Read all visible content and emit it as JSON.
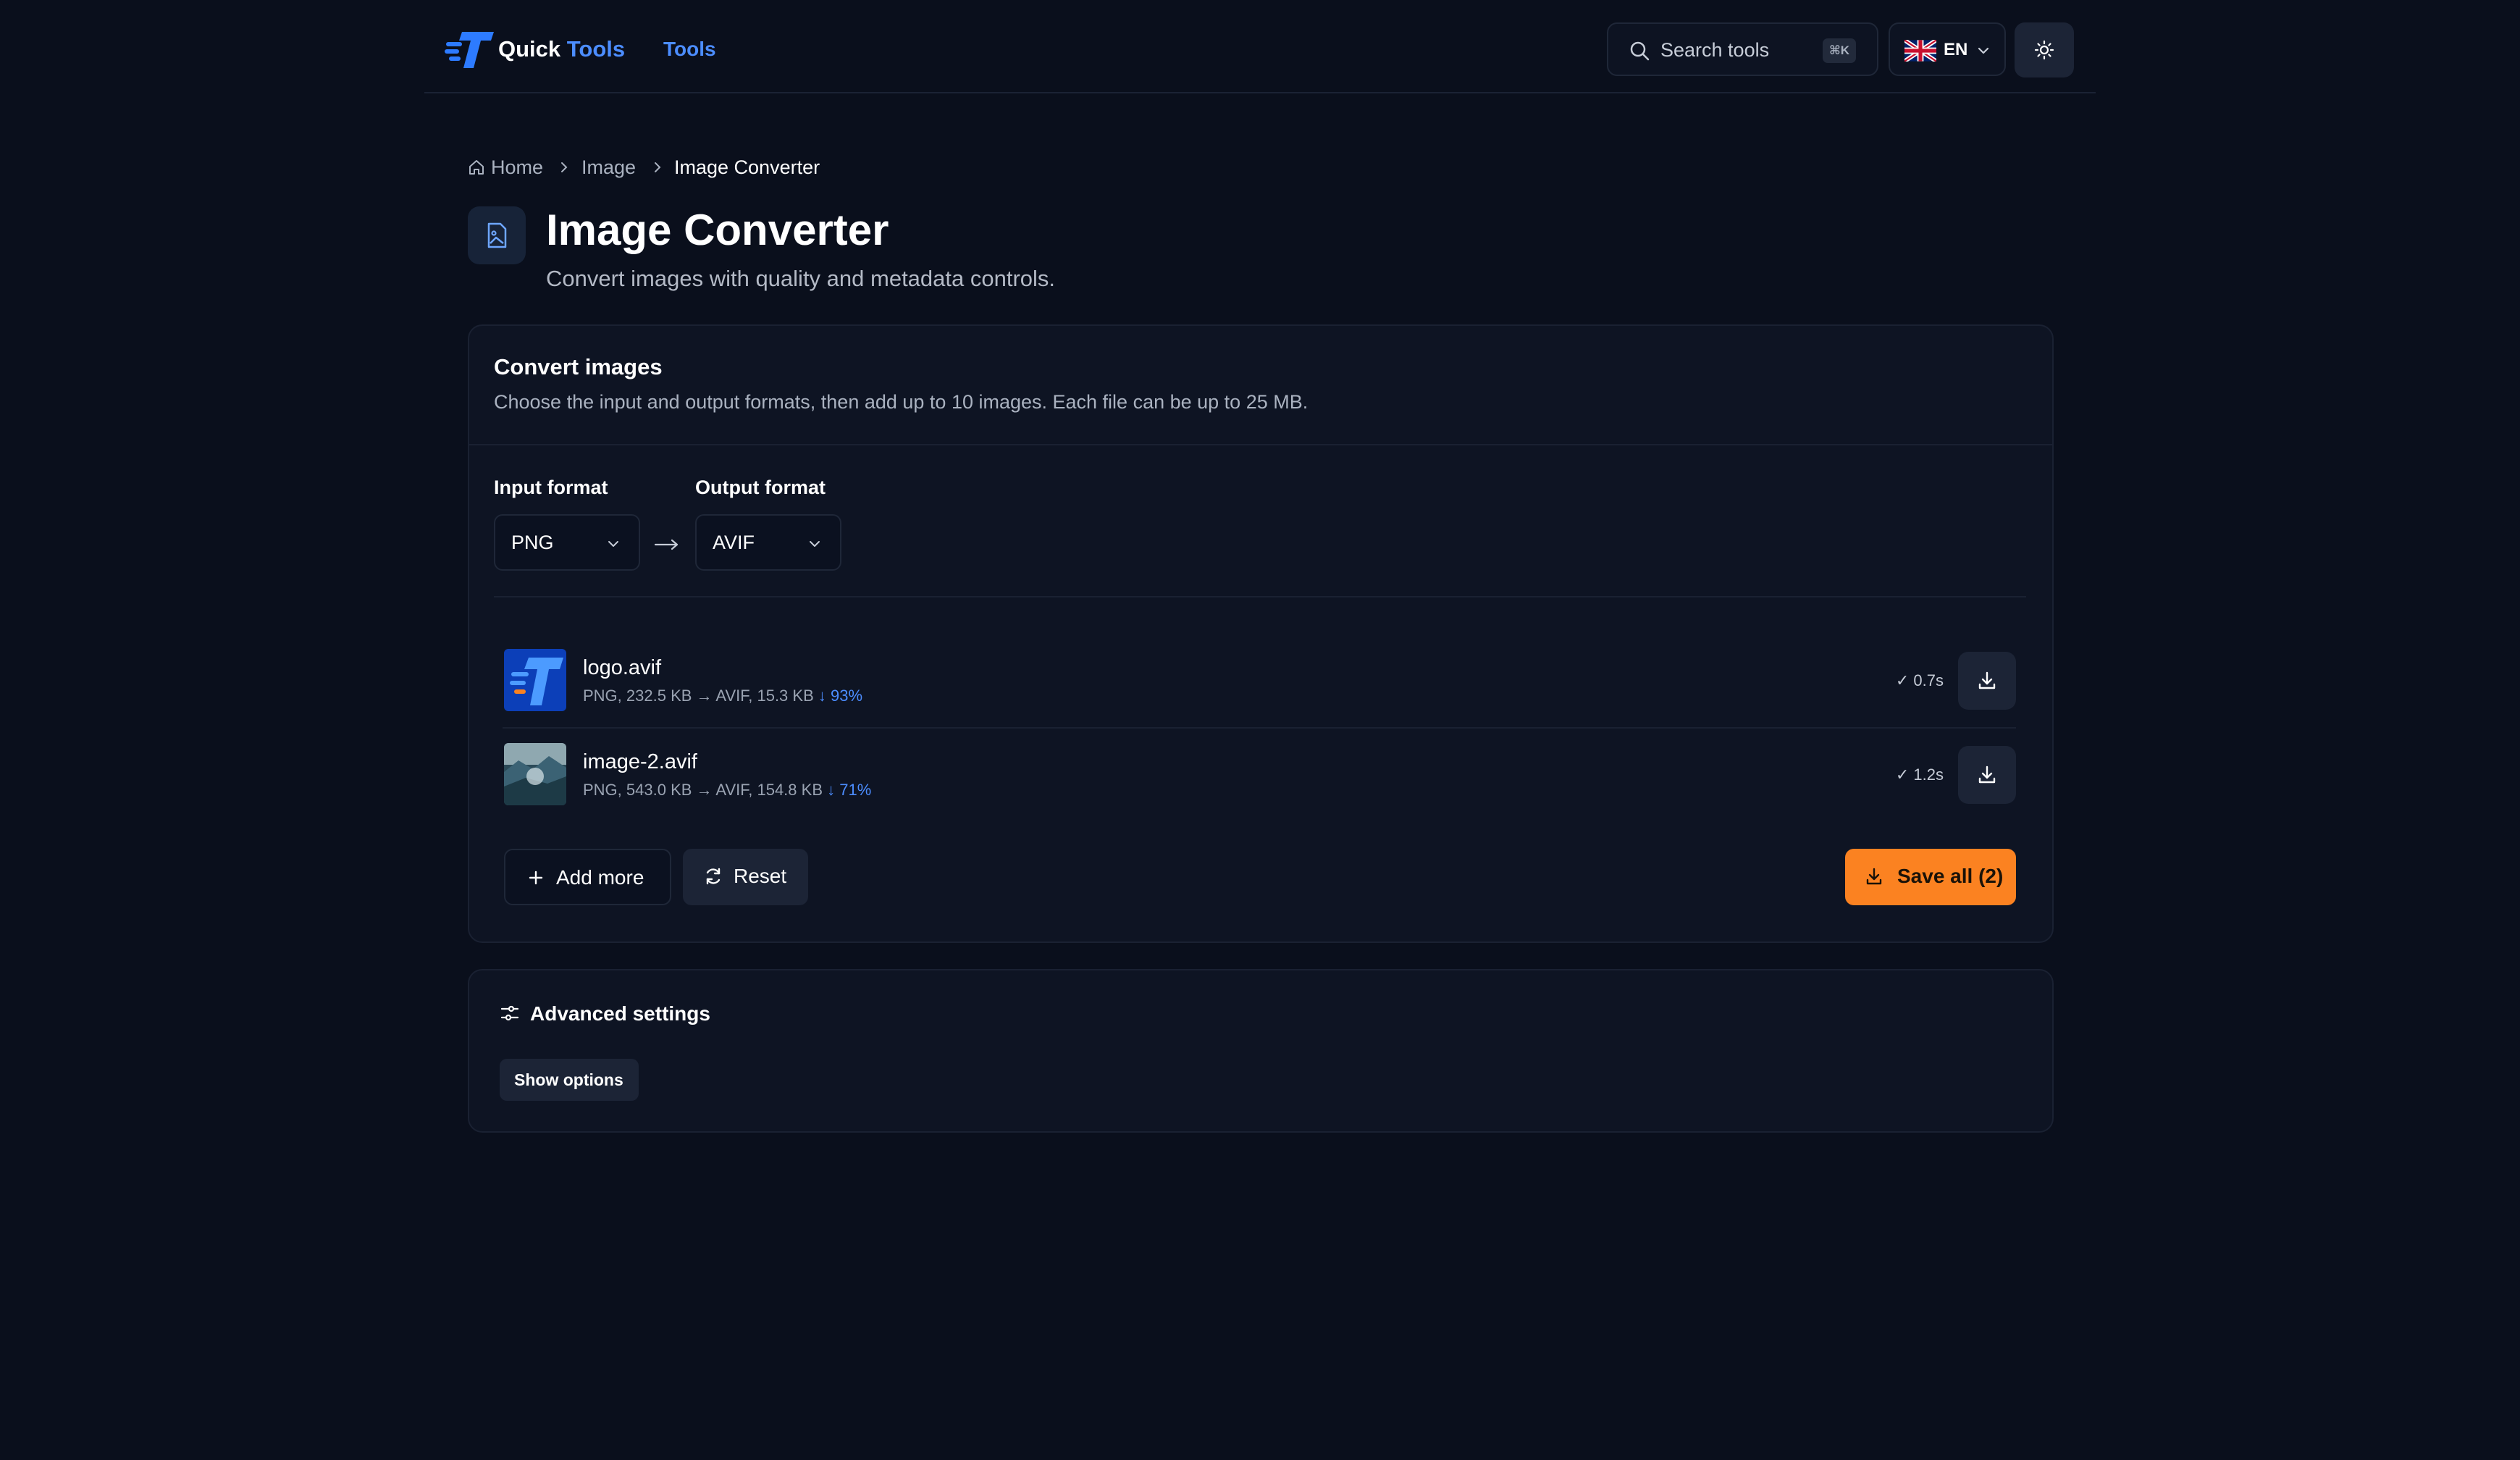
{
  "header": {
    "brand_first": "Quick",
    "brand_second": "Tools",
    "nav_tools": "Tools",
    "search_placeholder": "Search tools",
    "search_shortcut": "⌘K",
    "language": "EN"
  },
  "breadcrumb": [
    "Home",
    "Image",
    "Image Converter"
  ],
  "page": {
    "title": "Image Converter",
    "subtitle": "Convert images with quality and metadata controls."
  },
  "converter": {
    "title": "Convert images",
    "description": "Choose the input and output formats, then add up to 10 images. Each file can be up to 25 MB.",
    "input_label": "Input format",
    "input_value": "PNG",
    "output_label": "Output format",
    "output_value": "AVIF",
    "files": [
      {
        "name": "logo.avif",
        "meta": "PNG, 232.5 KB → AVIF, 15.3 KB",
        "saving": "↓ 93%",
        "time": "✓ 0.7s"
      },
      {
        "name": "image-2.avif",
        "meta": "PNG, 543.0 KB → AVIF, 154.8 KB",
        "saving": "↓ 71%",
        "time": "✓ 1.2s"
      }
    ],
    "add_more": "Add more",
    "reset": "Reset",
    "save_all": "Save all (2)"
  },
  "advanced": {
    "title": "Advanced settings",
    "show_options": "Show options"
  },
  "colors": {
    "background": "#0a0f1c",
    "accent": "#4c8dff",
    "primary_button": "#fb8221"
  }
}
